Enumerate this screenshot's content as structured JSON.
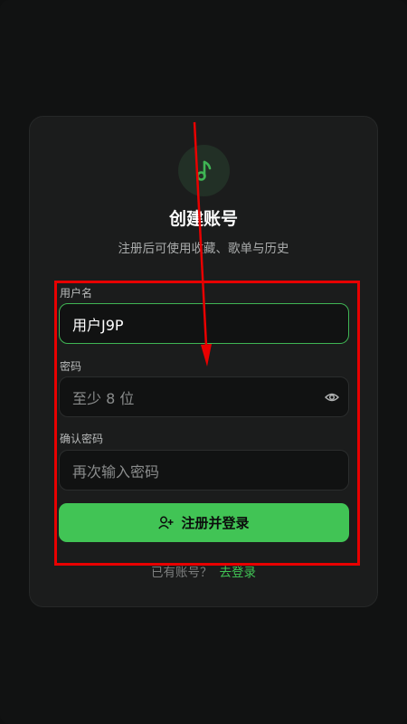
{
  "header": {
    "logo_icon": "music-note-icon",
    "title": "创建账号",
    "subtitle": "注册后可使用收藏、歌单与历史"
  },
  "form": {
    "username": {
      "label": "用户名",
      "value": "用户J9P",
      "placeholder": ""
    },
    "password": {
      "label": "密码",
      "value": "",
      "placeholder": "至少 8 位",
      "toggle_icon": "eye-icon"
    },
    "confirm": {
      "label": "确认密码",
      "value": "",
      "placeholder": "再次输入密码"
    },
    "submit": {
      "label": "注册并登录",
      "icon": "user-plus-icon"
    }
  },
  "footer": {
    "prompt": "已有账号？",
    "login_link": "去登录"
  },
  "colors": {
    "accent": "#41c455",
    "background": "#111212",
    "card": "#1b1c1c",
    "annotation": "#e80000"
  }
}
